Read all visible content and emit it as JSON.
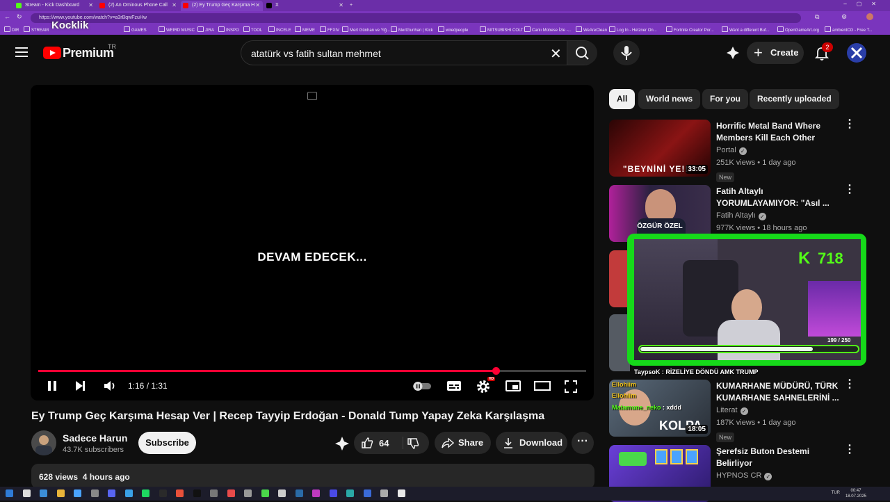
{
  "browser": {
    "tabs": [
      {
        "title": "Stream - Kick Dashboard",
        "color": "#53fc18"
      },
      {
        "title": "(2) An Ominous Phone Call",
        "color": "#ff0000"
      },
      {
        "title": "(2) Ey Trump Geç Karşıma H",
        "color": "#ff0000"
      },
      {
        "title": "X",
        "color": "#000000"
      }
    ],
    "url": "https://www.youtube.com/watch?v=a3rBqwFzuHw",
    "bookmarks": [
      "DIR",
      "STREAM",
      "GAMES",
      "WEIRD MUSIC",
      "JIRA",
      "INSPO",
      "TOOL",
      "INCELE",
      "MEME",
      "FFXIV",
      "Mert Günhan ve Yiğ...",
      "MertGunhan | Kick",
      "wiredpeople",
      "MITSUBISHI COLT",
      "Canlı Mobese İzle -...",
      "WeAreClean",
      "Log In - Hetzner On...",
      "Fortnite Creator Por...",
      "Want a different Buf...",
      "OpenGameArt.org",
      "ambientCG - Free T..."
    ]
  },
  "watermark": "Kocklik",
  "header": {
    "logo_word": "Premium",
    "country": "TR",
    "search_value": "atatürk vs fatih sultan mehmet",
    "create_label": "Create",
    "notifications": "2"
  },
  "player": {
    "overlay_text": "DEVAM EDECEK...",
    "time": "1:16 / 1:31",
    "progress": 0.835,
    "hd_label": "HD"
  },
  "video": {
    "title": "Ey Trump Geç Karşıma Hesap Ver | Recep Tayyip Erdoğan - Donald Tump Yapay Zeka Karşılaşma",
    "channel": "Sadece Harun",
    "subscribers": "43.7K subscribers",
    "subscribe_label": "Subscribe",
    "likes": "64",
    "share_label": "Share",
    "download_label": "Download",
    "views": "628 views",
    "age": "4 hours ago"
  },
  "chips": [
    "All",
    "World news",
    "For you",
    "Recently uploaded"
  ],
  "recommendations": [
    {
      "title": "Horrific Metal Band Where Members Kill Each Other",
      "channel": "Portal",
      "verified": true,
      "meta": "251K views • 1 day ago",
      "badge": "New",
      "duration": "33:05",
      "thumb_text": "\"BEYNİNİ YE!!!\"",
      "thumb_color": "#6a0c0c"
    },
    {
      "title": "Fatih Altaylı YORUMLAYAMIYOR: \"Asıl ...",
      "channel": "Fatih Altaylı",
      "verified": true,
      "meta": "977K views • 18 hours ago",
      "badge": "",
      "duration": "",
      "thumb_text": "ÖZGÜR ÖZEL",
      "thumb_color": "#3a2e4a"
    },
    {
      "title": "KUMARHANE MÜDÜRÜ, TÜRK KUMARHANE SAHNELERİNİ ...",
      "channel": "Literat",
      "verified": true,
      "meta": "187K views • 1 day ago",
      "badge": "New",
      "duration": "18:05",
      "thumb_text": "KOLPA",
      "thumb_color": "#4a5a6a"
    },
    {
      "title": "Şerefsiz Buton Destemi Belirliyor",
      "channel": "HYPNOS CR",
      "verified": true,
      "meta": "",
      "badge": "",
      "duration": "",
      "thumb_text": "",
      "thumb_color": "#3b2a8a"
    }
  ],
  "stream_overlay": {
    "kick_count": "718",
    "goal_text": "199 / 250",
    "goal_progress": 0.796
  },
  "chat": [
    {
      "user": "TaypsoK",
      "message": "RİZELİYE DÖNDÜ AMK TRUMP",
      "color": "#ffffff"
    },
    {
      "user": "Ellohiim",
      "message": "",
      "color": "#f5c518"
    },
    {
      "user": "Ellohiim",
      "message": "",
      "color": "#f5c518"
    },
    {
      "user": "Matamune_neko",
      "message": "xddd",
      "color": "#53fc18"
    }
  ],
  "taskbar": {
    "lang": "TUR",
    "time": "00:47",
    "date": "18.07.2025"
  },
  "colors": {
    "accent": "#ff0033",
    "kick_green": "#53fc18",
    "browser_purple": "#7a35bd"
  }
}
